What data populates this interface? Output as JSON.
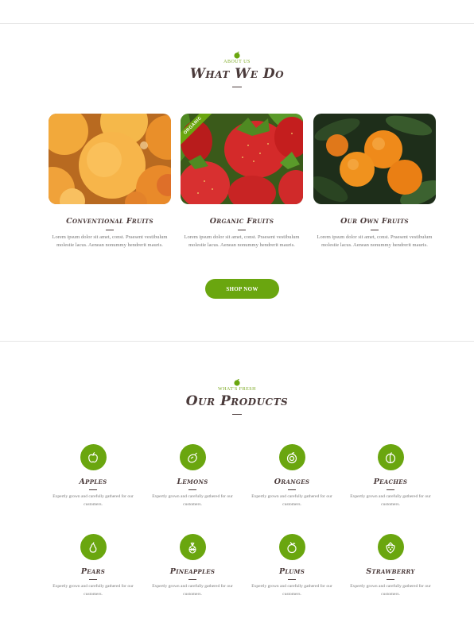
{
  "about": {
    "eyebrow": "ABOUT US",
    "title": "What We Do",
    "cards": [
      {
        "title": "Conventional Fruits",
        "text": "Lorem ipsum dolor sit amet, const. Praesent vestibulum molestie lacus. Aenean nonummy hendrerit mauris.",
        "image": "peaches-photo"
      },
      {
        "title": "Organic Fruits",
        "text": "Lorem ipsum dolor sit amet, const. Praesent vestibulum molestie lacus. Aenean nonummy hendrerit mauris.",
        "image": "strawberries-photo",
        "ribbon": "ORGANIC"
      },
      {
        "title": "Our Own Fruits",
        "text": "Lorem ipsum dolor sit amet, const. Praesent vestibulum molestie lacus. Aenean nonummy hendrerit mauris.",
        "image": "oranges-photo"
      }
    ],
    "button": "SHOP NOW"
  },
  "products": {
    "eyebrow": "WHAT'S FRESH",
    "title": "Our Products",
    "items": [
      {
        "name": "Apples",
        "icon": "apple-icon",
        "text": "Expertly grown and carefully gathered for our customers."
      },
      {
        "name": "Lemons",
        "icon": "lemon-icon",
        "text": "Expertly grown and carefully gathered for our customers."
      },
      {
        "name": "Oranges",
        "icon": "orange-icon",
        "text": "Expertly grown and carefully gathered for our customers."
      },
      {
        "name": "Peaches",
        "icon": "peach-icon",
        "text": "Expertly grown and carefully gathered for our customers."
      },
      {
        "name": "Pears",
        "icon": "pear-icon",
        "text": "Expertly grown and carefully gathered for our customers."
      },
      {
        "name": "Pineapples",
        "icon": "pineapple-icon",
        "text": "Expertly grown and carefully gathered for our customers."
      },
      {
        "name": "Plums",
        "icon": "plum-icon",
        "text": "Expertly grown and carefully gathered for our customers."
      },
      {
        "name": "Strawberry",
        "icon": "strawberry-icon",
        "text": "Expertly grown and carefully gathered for our customers."
      }
    ]
  },
  "colors": {
    "accent": "#6aa60f",
    "heading": "#4a3a3a",
    "body_text": "#777777"
  }
}
